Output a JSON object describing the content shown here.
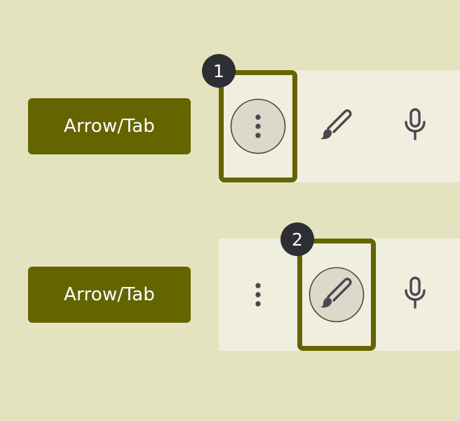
{
  "colors": {
    "background": "#e4e3bf",
    "key_button": "#646400",
    "toolbar": "#f0eedf",
    "focus_ring": "#646400",
    "selected_circle": "#dbd9c9",
    "selected_circle_border": "#45463b",
    "icon": "#4a4950",
    "badge": "#2e2f33"
  },
  "steps": [
    {
      "badge": "1",
      "key_label": "Arrow/Tab",
      "focused_tool": "more-options",
      "tools": [
        {
          "name": "more-options",
          "icon": "more-vert-icon"
        },
        {
          "name": "brush",
          "icon": "brush-icon"
        },
        {
          "name": "microphone",
          "icon": "mic-icon"
        }
      ]
    },
    {
      "badge": "2",
      "key_label": "Arrow/Tab",
      "focused_tool": "brush",
      "tools": [
        {
          "name": "more-options",
          "icon": "more-vert-icon"
        },
        {
          "name": "brush",
          "icon": "brush-icon"
        },
        {
          "name": "microphone",
          "icon": "mic-icon"
        }
      ]
    }
  ]
}
